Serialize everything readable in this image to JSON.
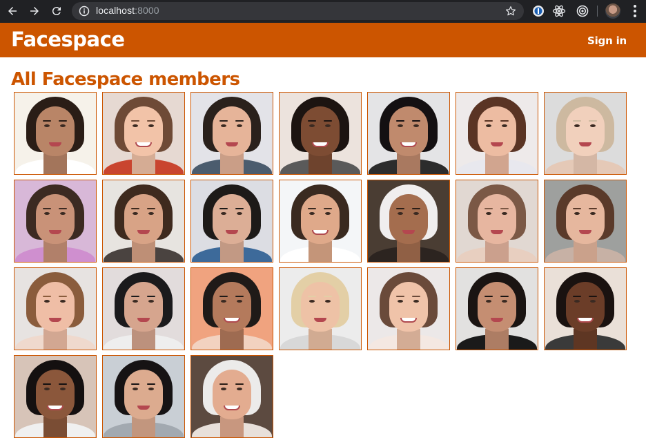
{
  "browser": {
    "url_host": "localhost",
    "url_port": ":8000",
    "icons": [
      "back-icon",
      "forward-icon",
      "reload-icon",
      "info-icon",
      "star-icon",
      "password-extension-icon",
      "react-devtools-icon",
      "target-extension-icon",
      "profile-avatar",
      "menu-icon"
    ]
  },
  "header": {
    "brand": "Facespace",
    "signin_label": "Sign in"
  },
  "page": {
    "title": "All Facespace members"
  },
  "colors": {
    "brand": "#cc5500",
    "header_text": "#ffffff",
    "chrome_bg": "#202124"
  },
  "members": [
    {
      "bg": "#f6f2ea",
      "skin": "#b98567",
      "hair": "#2a1d16",
      "shirt": "#ffffff",
      "smile": false
    },
    {
      "bg": "#e6d9d2",
      "skin": "#f2c3a8",
      "hair": "#6e4a36",
      "shirt": "#c9452f",
      "smile": true
    },
    {
      "bg": "#e3e3e8",
      "skin": "#e6b499",
      "hair": "#2a211c",
      "shirt": "#4b5c6e",
      "smile": false
    },
    {
      "bg": "#ece3dd",
      "skin": "#7d4c33",
      "hair": "#1c1411",
      "shirt": "#5a5a5a",
      "smile": true
    },
    {
      "bg": "#e4e4e6",
      "skin": "#c08a6d",
      "hair": "#141012",
      "shirt": "#2c2c2c",
      "smile": true
    },
    {
      "bg": "#eeeaea",
      "skin": "#edbca2",
      "hair": "#5a3424",
      "shirt": "#e8e8ee",
      "smile": false
    },
    {
      "bg": "#dcdcdc",
      "skin": "#f1d0bc",
      "hair": "#cdb9a0",
      "shirt": "#e5c9b7",
      "smile": false
    },
    {
      "bg": "#d8b8d8",
      "skin": "#c99278",
      "hair": "#3c2a22",
      "shirt": "#cf8fcf",
      "smile": false
    },
    {
      "bg": "#e7e4e0",
      "skin": "#d8a386",
      "hair": "#3e2a1e",
      "shirt": "#4a4340",
      "smile": false
    },
    {
      "bg": "#dcdde3",
      "skin": "#dcae96",
      "hair": "#1d1a18",
      "shirt": "#3d6a9a",
      "smile": false
    },
    {
      "bg": "#f4f6f8",
      "skin": "#dfa98a",
      "hair": "#3a2a20",
      "shirt": "#ffffff",
      "smile": true
    },
    {
      "bg": "#4a3d33",
      "skin": "#a46d4e",
      "hair": "#f0eeee",
      "shirt": "#2c2420",
      "smile": false
    },
    {
      "bg": "#e1d8d2",
      "skin": "#e7b6a0",
      "hair": "#7b5845",
      "shirt": "#e8cfc0",
      "smile": false
    },
    {
      "bg": "#9ea09e",
      "skin": "#e6b79e",
      "hair": "#5a3a2a",
      "shirt": "#c7b1a5",
      "smile": false
    },
    {
      "bg": "#e7e3e1",
      "skin": "#efbea6",
      "hair": "#8a5c3c",
      "shirt": "#efd9cd",
      "smile": false
    },
    {
      "bg": "#e2dcdc",
      "skin": "#d6a58e",
      "hair": "#1b1a1c",
      "shirt": "#eeeeee",
      "smile": false
    },
    {
      "bg": "#f0a37f",
      "skin": "#b47a5c",
      "hair": "#1f1a18",
      "shirt": "#f2d2c0",
      "smile": true
    },
    {
      "bg": "#ececec",
      "skin": "#eec2a6",
      "hair": "#e3cfa6",
      "shirt": "#d8d8d8",
      "smile": false
    },
    {
      "bg": "#ece8e8",
      "skin": "#f0c3a9",
      "hair": "#6a4a3a",
      "shirt": "#f4e8e2",
      "smile": true
    },
    {
      "bg": "#e2e1e0",
      "skin": "#c58e72",
      "hair": "#1a1412",
      "shirt": "#1a1a1a",
      "smile": false
    },
    {
      "bg": "#eae0d8",
      "skin": "#6b3d28",
      "hair": "#1a1210",
      "shirt": "#3a3a3a",
      "smile": true
    },
    {
      "bg": "#d7c4b8",
      "skin": "#8b573b",
      "hair": "#141010",
      "shirt": "#f0f0f0",
      "smile": true
    },
    {
      "bg": "#c9cfd5",
      "skin": "#dcab8f",
      "hair": "#161314",
      "shirt": "#a2a9b0",
      "smile": false
    },
    {
      "bg": "#5c4a40",
      "skin": "#e3ac90",
      "hair": "#ecebea",
      "shirt": "#e8e0da",
      "smile": true
    }
  ]
}
